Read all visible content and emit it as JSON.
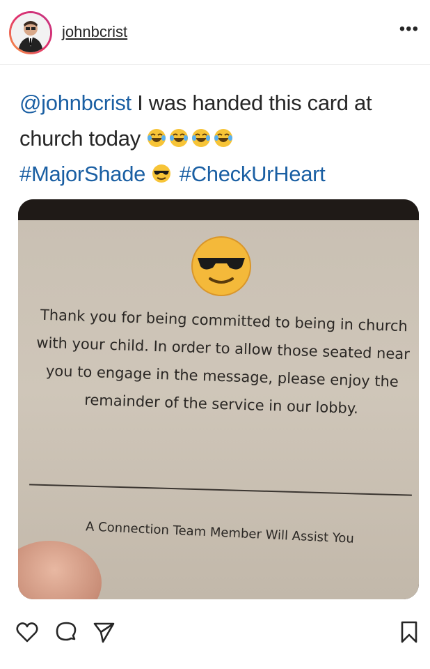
{
  "post": {
    "username": "johnbcrist",
    "more_icon": "ellipsis-icon",
    "caption": {
      "mention": "@johnbcrist",
      "text": " I was handed this card at church today",
      "hashtag1": "#MajorShade",
      "hashtag2": "#CheckUrHeart"
    },
    "photo_card": {
      "message": "Thank you for being committed to being in church with your child. In order to allow those seated near you to engage in the message, please enjoy the remainder of the service in our lobby.",
      "footer": "A Connection Team Member Will Assist You"
    },
    "actions": [
      "heart-icon",
      "comment-icon",
      "share-icon",
      "bookmark-icon"
    ]
  },
  "colors": {
    "link": "#1a5fa3",
    "text": "#262626"
  }
}
